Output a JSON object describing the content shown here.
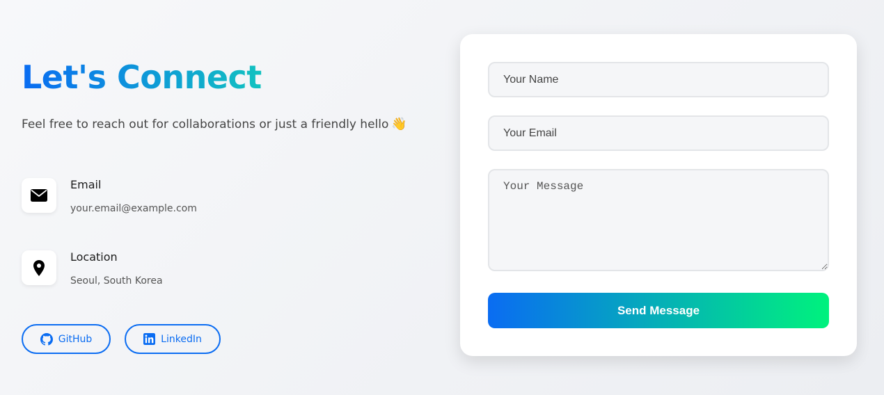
{
  "hero": {
    "title": "Let's Connect",
    "subtitle": "Feel free to reach out for collaborations or just a friendly hello",
    "subtitle_emoji": "👋"
  },
  "contact_info": {
    "email": {
      "label": "Email",
      "value": "your.email@example.com",
      "icon": "envelope-icon"
    },
    "location": {
      "label": "Location",
      "value": "Seoul, South Korea",
      "icon": "map-pin-icon"
    }
  },
  "social": {
    "github": {
      "label": "GitHub",
      "icon": "github-icon"
    },
    "linkedin": {
      "label": "LinkedIn",
      "icon": "linkedin-icon"
    }
  },
  "form": {
    "name_placeholder": "Your Name",
    "email_placeholder": "Your Email",
    "message_placeholder": "Your Message",
    "submit_label": "Send Message"
  },
  "colors": {
    "accent_blue": "#0a6cf2",
    "accent_teal": "#12c2c0",
    "accent_green": "#00f27d",
    "background": "#f2f3f6",
    "card": "#ffffff"
  }
}
